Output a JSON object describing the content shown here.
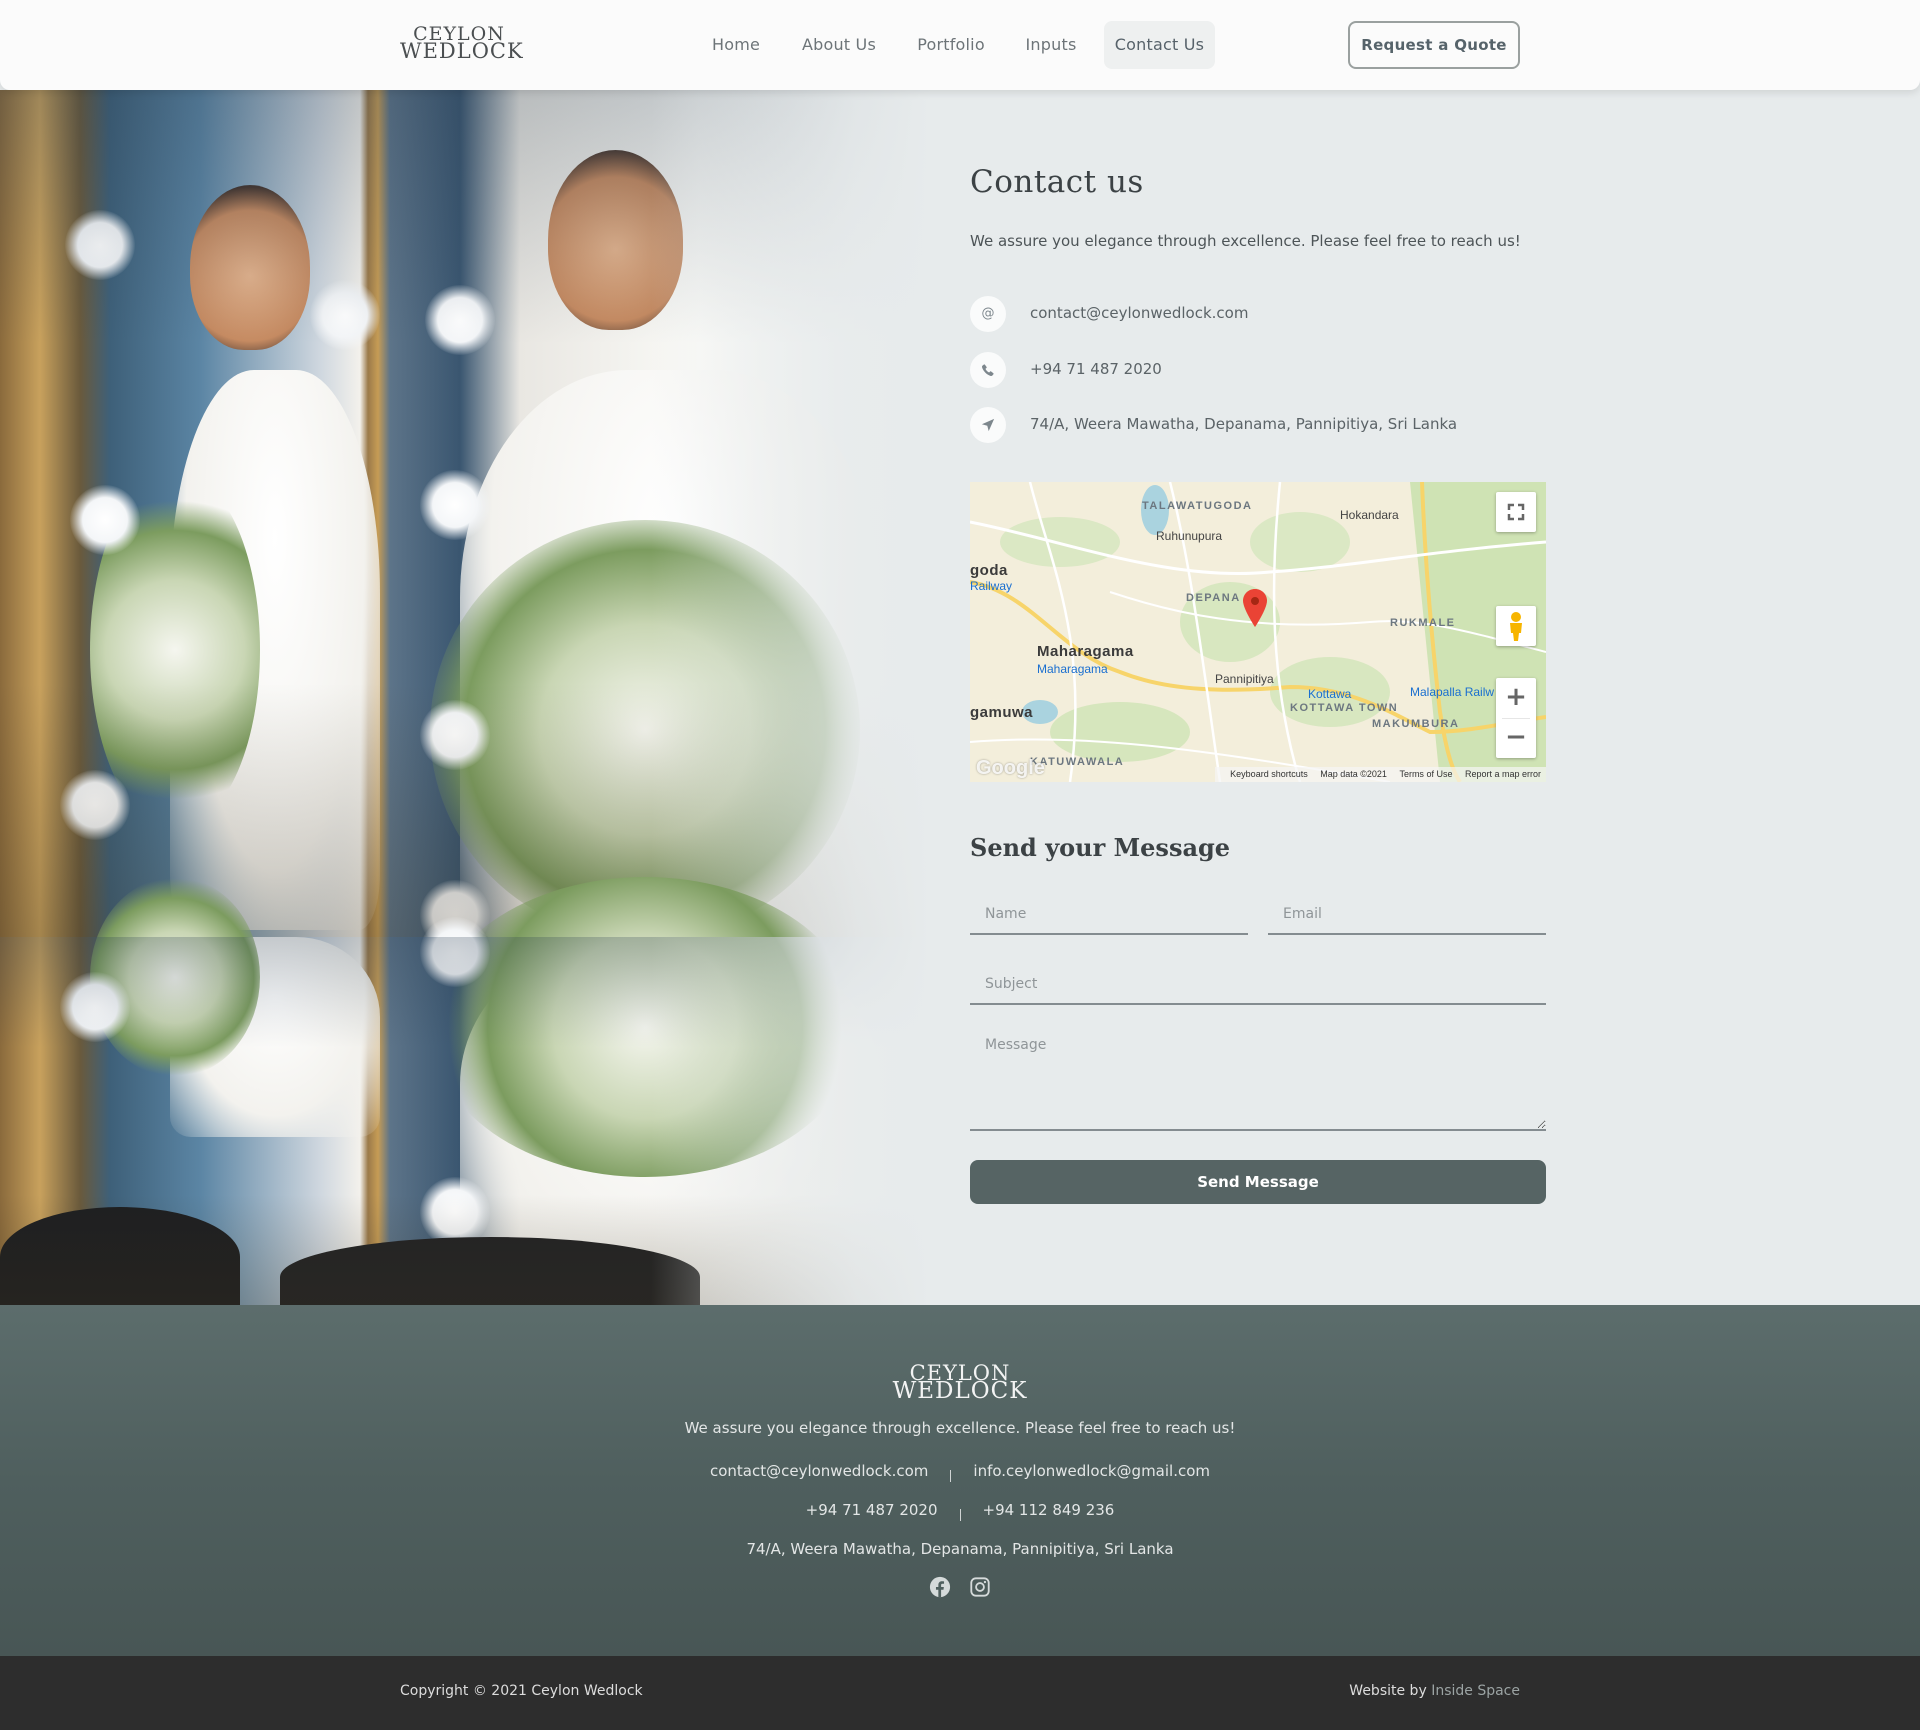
{
  "header": {
    "logo": {
      "line1": "CEYLON",
      "line2": "WEDLOCK"
    },
    "nav": [
      {
        "label": "Home",
        "active": false
      },
      {
        "label": "About Us",
        "active": false
      },
      {
        "label": "Portfolio",
        "active": false
      },
      {
        "label": "Inputs",
        "active": false
      },
      {
        "label": "Contact Us",
        "active": true
      }
    ],
    "cta_label": "Request a Quote"
  },
  "hero": {
    "image_description": "Bride in white saree holding a bouquet, smiling into a lit vanity mirror"
  },
  "contact": {
    "title": "Contact us",
    "tagline": "We assure you elegance through excellence. Please feel free to reach us!",
    "items": [
      {
        "icon": "at-icon",
        "glyph": "@",
        "text": "contact@ceylonwedlock.com"
      },
      {
        "icon": "phone-icon",
        "text": "+94 71 487 2020"
      },
      {
        "icon": "location-arrow-icon",
        "text": "74/A, Weera Mawatha, Depanama, Pannipitiya, Sri Lanka"
      }
    ]
  },
  "map": {
    "labels": {
      "talawatugoda": "TALAWATUGODA",
      "hokandara": "Hokandara",
      "ruhunupura": "Ruhunupura",
      "goda": "goda",
      "railway": "Railway",
      "depanama": "DEPANA",
      "rukmale": "RUKMALE",
      "maharagama": "Maharagama",
      "maharagama_station": "Maharagama",
      "pannipitiya": "Pannipitiya",
      "kottawa": "Kottawa",
      "malapalla": "Malapalla Railw",
      "kottawa_town": "KOTTAWA TOWN",
      "makumbura": "MAKUMBURA",
      "gamuwa": "gamuwa",
      "katuwawala": "KATUWAWALA"
    },
    "google_logo": "Google",
    "attribution": {
      "shortcuts": "Keyboard shortcuts",
      "data": "Map data ©2021",
      "terms": "Terms of Use",
      "report": "Report a map error"
    },
    "controls": {
      "zoom_in": "+",
      "zoom_out": "−"
    }
  },
  "form": {
    "title": "Send your Message",
    "fields": {
      "name": {
        "placeholder": "Name",
        "value": ""
      },
      "email": {
        "placeholder": "Email",
        "value": ""
      },
      "subject": {
        "placeholder": "Subject",
        "value": ""
      },
      "message": {
        "placeholder": "Message",
        "value": ""
      }
    },
    "submit_label": "Send Message"
  },
  "footer": {
    "logo": {
      "line1": "CEYLON",
      "line2": "WEDLOCK"
    },
    "tagline": "We assure you elegance through excellence. Please feel free to reach us!",
    "emails": [
      "contact@ceylonwedlock.com",
      "info.ceylonwedlock@gmail.com"
    ],
    "phones": [
      "+94 71 487 2020",
      "+94 112 849 236"
    ],
    "address": "74/A, Weera Mawatha, Depanama, Pannipitiya, Sri Lanka",
    "social": [
      "facebook-icon",
      "instagram-icon"
    ]
  },
  "bottom_bar": {
    "copyright": "Copyright © 2021 Ceylon Wedlock",
    "credit_prefix": "Website by ",
    "credit_link": "Inside Space"
  },
  "colors": {
    "page_bg": "#e7ebec",
    "accent": "#566464",
    "footer_bg": "#556564",
    "bottom_bar_bg": "#2d2d2d"
  }
}
